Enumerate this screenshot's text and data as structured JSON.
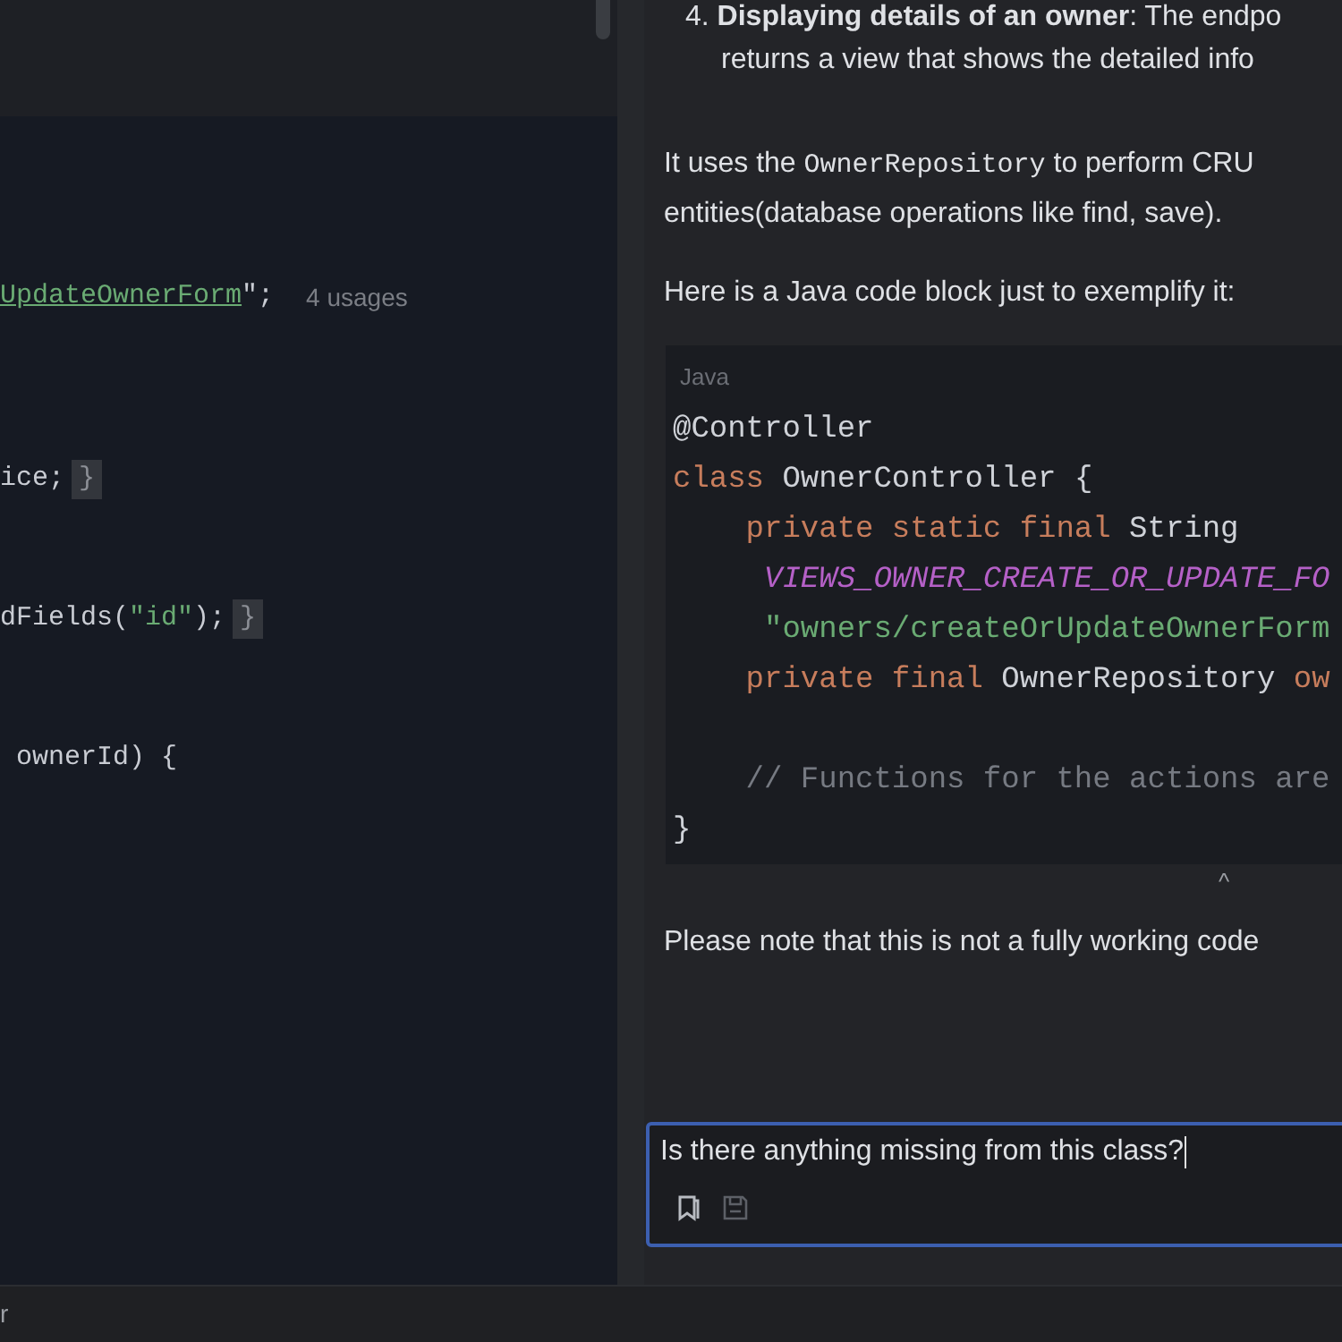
{
  "editor": {
    "lines": [
      {
        "tokens": [
          {
            "kind": "string-link",
            "text": "UpdateOwnerForm"
          },
          {
            "kind": "plain",
            "text": "\";"
          }
        ],
        "hint": "4 usages"
      },
      {
        "tokens": [
          {
            "kind": "plain",
            "text": "ice;"
          },
          {
            "kind": "fold",
            "text": "}"
          }
        ]
      },
      {
        "tokens": [
          {
            "kind": "plain",
            "text": "dFields("
          },
          {
            "kind": "string",
            "text": "\"id\""
          },
          {
            "kind": "plain",
            "text": ");"
          },
          {
            "kind": "fold",
            "text": "}"
          }
        ]
      },
      {
        "tokens": [
          {
            "kind": "plain",
            "text": " ownerId) {"
          }
        ]
      }
    ]
  },
  "chat": {
    "list_item": {
      "line_1": "4. **Displaying details of an owner**: The endpo",
      "line_2": "returns a view that shows the detailed info"
    },
    "paragraphs": [
      [
        {
          "kind": "text",
          "text": "It uses the "
        },
        {
          "kind": "code",
          "text": "OwnerRepository"
        },
        {
          "kind": "text",
          "text": " to perform CRU"
        }
      ],
      [
        {
          "kind": "text",
          "text": "entities(database operations like find, save)."
        }
      ],
      [
        {
          "kind": "text",
          "text": "Here is a Java code block just to exemplify it:"
        }
      ]
    ],
    "code_block": {
      "language": "Java",
      "lines": [
        [
          {
            "kind": "plain",
            "text": "@Controller"
          }
        ],
        [
          {
            "kind": "keyword",
            "text": "class"
          },
          {
            "kind": "plain",
            "text": " OwnerController {"
          }
        ],
        [
          {
            "kind": "keyword",
            "text": "    private static final"
          },
          {
            "kind": "plain",
            "text": " String"
          }
        ],
        [
          {
            "kind": "constant",
            "text": "     VIEWS_OWNER_CREATE_OR_UPDATE_FO"
          }
        ],
        [
          {
            "kind": "string",
            "text": "     \"owners/createOrUpdateOwnerForm"
          }
        ],
        [
          {
            "kind": "keyword",
            "text": "    private final"
          },
          {
            "kind": "plain",
            "text": " OwnerRepository "
          },
          {
            "kind": "field",
            "text": "ow"
          }
        ],
        [
          {
            "kind": "comment",
            "text": "    // Functions for the actions are"
          }
        ],
        [
          {
            "kind": "plain",
            "text": "}"
          }
        ]
      ]
    },
    "collapse_icon": "^",
    "note": "Please note that this is not a fully working code",
    "input": {
      "value": "Is there anything missing from this class?"
    }
  },
  "status_bar": {
    "text": "r"
  }
}
